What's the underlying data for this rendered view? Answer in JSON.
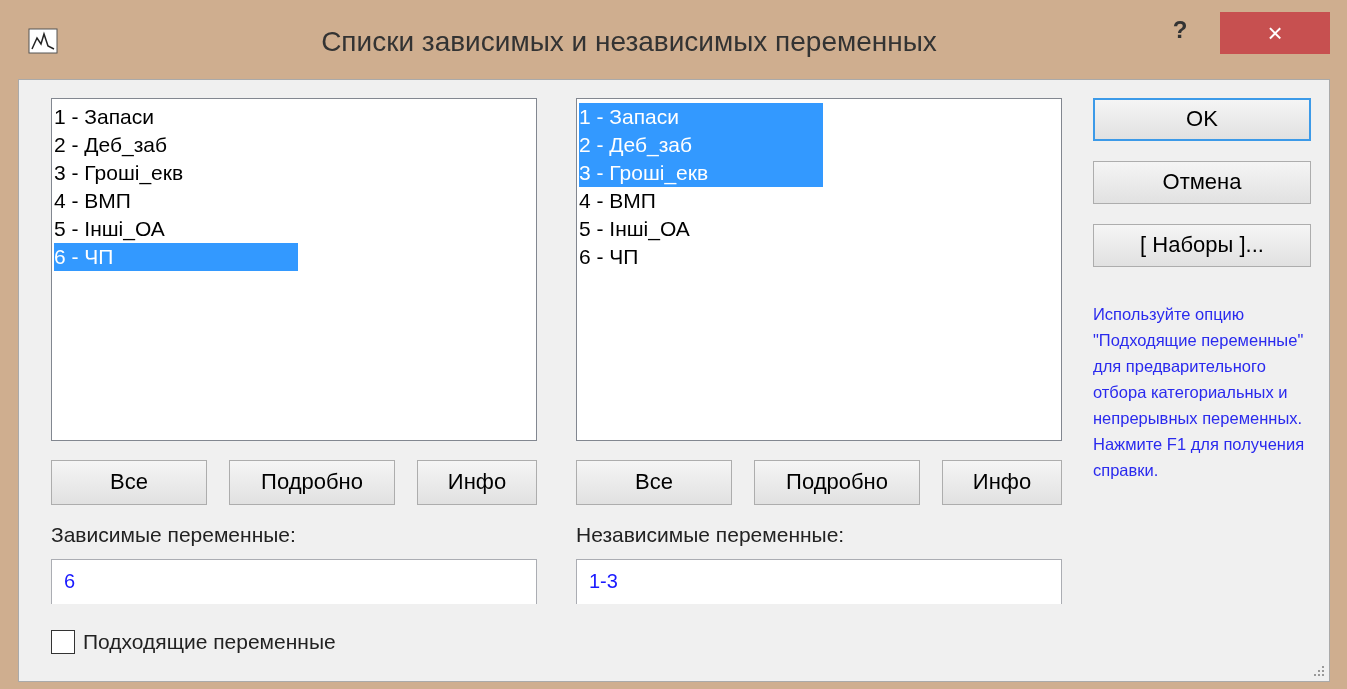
{
  "window": {
    "title": "Списки зависимых и независимых переменных",
    "help": "?",
    "close": "×"
  },
  "lists": [
    {
      "items": [
        {
          "label": "1 - Запаси",
          "selected": false
        },
        {
          "label": "2 - Деб_заб",
          "selected": false
        },
        {
          "label": "3 - Гроші_екв",
          "selected": false
        },
        {
          "label": "4 - ВМП",
          "selected": false
        },
        {
          "label": "5 - Інші_ОА",
          "selected": false
        },
        {
          "label": "6 - ЧП",
          "selected": true
        }
      ],
      "buttons": [
        "Все",
        "Подробно",
        "Инфо"
      ],
      "field_label": "Зависимые переменные:",
      "field_value": "6"
    },
    {
      "items": [
        {
          "label": "1 - Запаси",
          "selected": true
        },
        {
          "label": "2 - Деб_заб",
          "selected": true
        },
        {
          "label": "3 - Гроші_екв",
          "selected": true
        },
        {
          "label": "4 - ВМП",
          "selected": false
        },
        {
          "label": "5 - Інші_ОА",
          "selected": false
        },
        {
          "label": "6 - ЧП",
          "selected": false
        }
      ],
      "buttons": [
        "Все",
        "Подробно",
        "Инфо"
      ],
      "field_label": "Независимые переменные:",
      "field_value": "1-3"
    }
  ],
  "checkbox": {
    "label": "Подходящие переменные",
    "checked": false
  },
  "side_buttons": [
    {
      "label": "OK",
      "default": true
    },
    {
      "label": "Отмена",
      "default": false
    },
    {
      "label": "[ Наборы ]...",
      "default": false
    }
  ],
  "hint": "Используйте опцию \"Подходящие переменные\" для предварительного отбора категориальных и непрерывных переменных. Нажмите F1 для получения справки."
}
